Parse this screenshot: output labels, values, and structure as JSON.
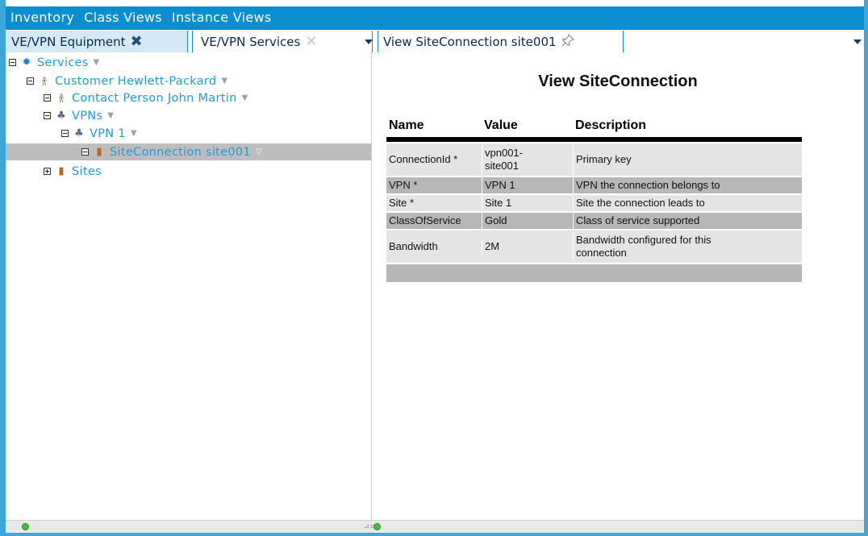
{
  "menu": {
    "items": [
      "Inventory",
      "Class Views",
      "Instance Views"
    ]
  },
  "tabs": [
    {
      "label": "VE/VPN Equipment"
    },
    {
      "label": "VE/VPN Services"
    },
    {
      "label": "View SiteConnection site001"
    }
  ],
  "tree": {
    "items": [
      {
        "label": "Services",
        "icon": "gear-icon"
      },
      {
        "label": "Customer Hewlett-Packard",
        "icon": "person-icon"
      },
      {
        "label": "Contact Person John Martin",
        "icon": "person-icon"
      },
      {
        "label": "VPNs",
        "icon": "vpn-icon"
      },
      {
        "label": "VPN 1",
        "icon": "vpn-icon"
      },
      {
        "label": "SiteConnection site001",
        "icon": "door-icon"
      },
      {
        "label": "Sites",
        "icon": "door-icon"
      }
    ]
  },
  "detail": {
    "title": "View SiteConnection",
    "columns": [
      "Name",
      "Value",
      "Description"
    ],
    "rows": [
      {
        "name": "ConnectionId *",
        "value": "vpn001-site001",
        "description": "Primary key"
      },
      {
        "name": "VPN *",
        "value": "VPN 1",
        "description": "VPN the connection belongs to"
      },
      {
        "name": "Site *",
        "value": "Site 1",
        "description": "Site the connection leads to"
      },
      {
        "name": "ClassOfService",
        "value": "Gold",
        "description": "Class of service supported"
      },
      {
        "name": "Bandwidth",
        "value": "2M",
        "description": "Bandwidth configured for this connection"
      }
    ]
  },
  "colors": {
    "accent": "#0b8ecf",
    "tree_text": "#1f9bd7",
    "selection": "#bdbdbd"
  }
}
